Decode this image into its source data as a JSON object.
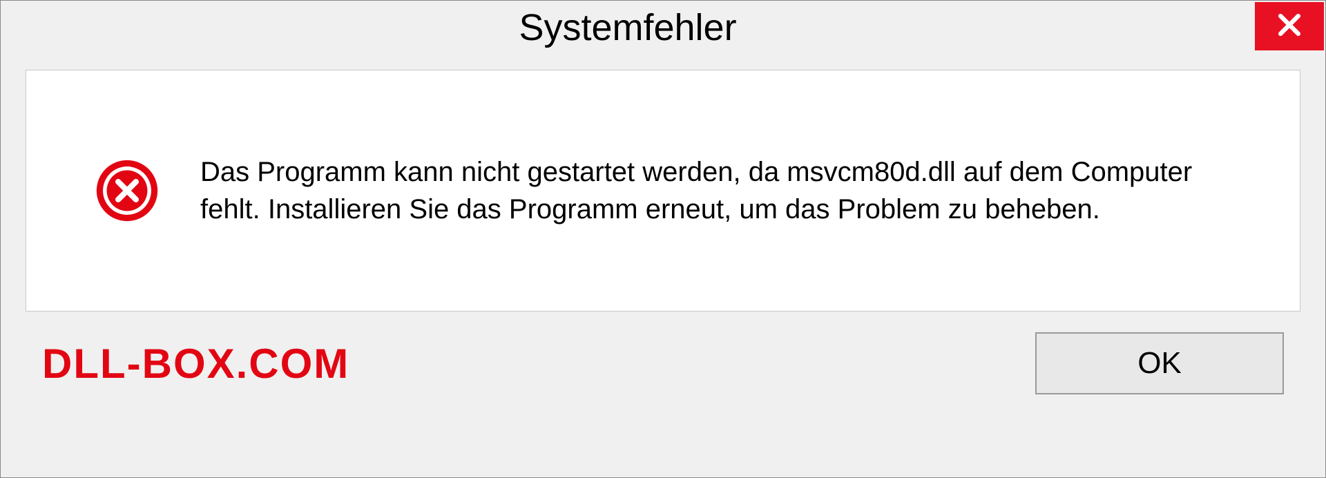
{
  "dialog": {
    "title": "Systemfehler",
    "message": "Das Programm kann nicht gestartet werden, da msvcm80d.dll auf dem Computer fehlt. Installieren Sie das Programm erneut, um das Problem zu beheben.",
    "ok_label": "OK"
  },
  "watermark": "DLL-BOX.COM"
}
